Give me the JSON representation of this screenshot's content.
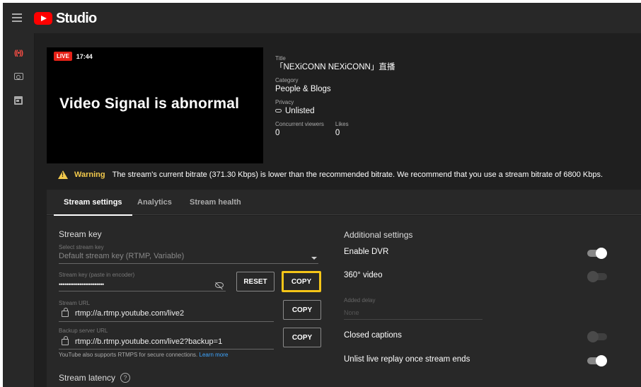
{
  "app": {
    "title": "Studio"
  },
  "preview": {
    "live_label": "LIVE",
    "elapsed": "17:44",
    "signal_message": "Video Signal is abnormal"
  },
  "details": {
    "title_label": "Title",
    "title": "「NEXiCONN NEXiCONN」直播",
    "category_label": "Category",
    "category": "People & Blogs",
    "privacy_label": "Privacy",
    "privacy": "Unlisted",
    "viewers_label": "Concurrent viewers",
    "viewers": "0",
    "likes_label": "Likes",
    "likes": "0"
  },
  "warning": {
    "title": "Warning",
    "message": "The stream's current bitrate (371.30 Kbps) is lower than the recommended bitrate. We recommend that you use a stream bitrate of 6800 Kbps.",
    "color": "#f2c94c"
  },
  "tabs": [
    {
      "label": "Stream settings",
      "active": true
    },
    {
      "label": "Analytics",
      "active": false
    },
    {
      "label": "Stream health",
      "active": false
    }
  ],
  "stream_key": {
    "section_title": "Stream key",
    "select_label": "Select stream key",
    "select_value": "Default stream key (RTMP, Variable)",
    "key_label": "Stream key (paste in encoder)",
    "key_value": "••••••••••••••••••••••••",
    "reset_label": "RESET",
    "copy_label": "COPY",
    "url_label": "Stream URL",
    "url_value": "rtmp://a.rtmp.youtube.com/live2",
    "url_copy_label": "COPY",
    "backup_label": "Backup server URL",
    "backup_value": "rtmp://b.rtmp.youtube.com/live2?backup=1",
    "backup_copy_label": "COPY",
    "note": "YouTube also supports RTMPS for secure connections.",
    "note_link": "Learn more",
    "latency_title": "Stream latency"
  },
  "additional": {
    "section_title": "Additional settings",
    "enable_dvr": {
      "label": "Enable DVR",
      "on": true
    },
    "video_360": {
      "label": "360° video",
      "on": false
    },
    "added_delay": {
      "label": "Added delay",
      "value": "None"
    },
    "closed_captions": {
      "label": "Closed captions",
      "on": false
    },
    "unlist_replay": {
      "label": "Unlist live replay once stream ends",
      "on": true
    }
  },
  "colors": {
    "live_red": "#e62117",
    "copy_highlight": "#f5c518",
    "link_blue": "#3ea6ff"
  }
}
